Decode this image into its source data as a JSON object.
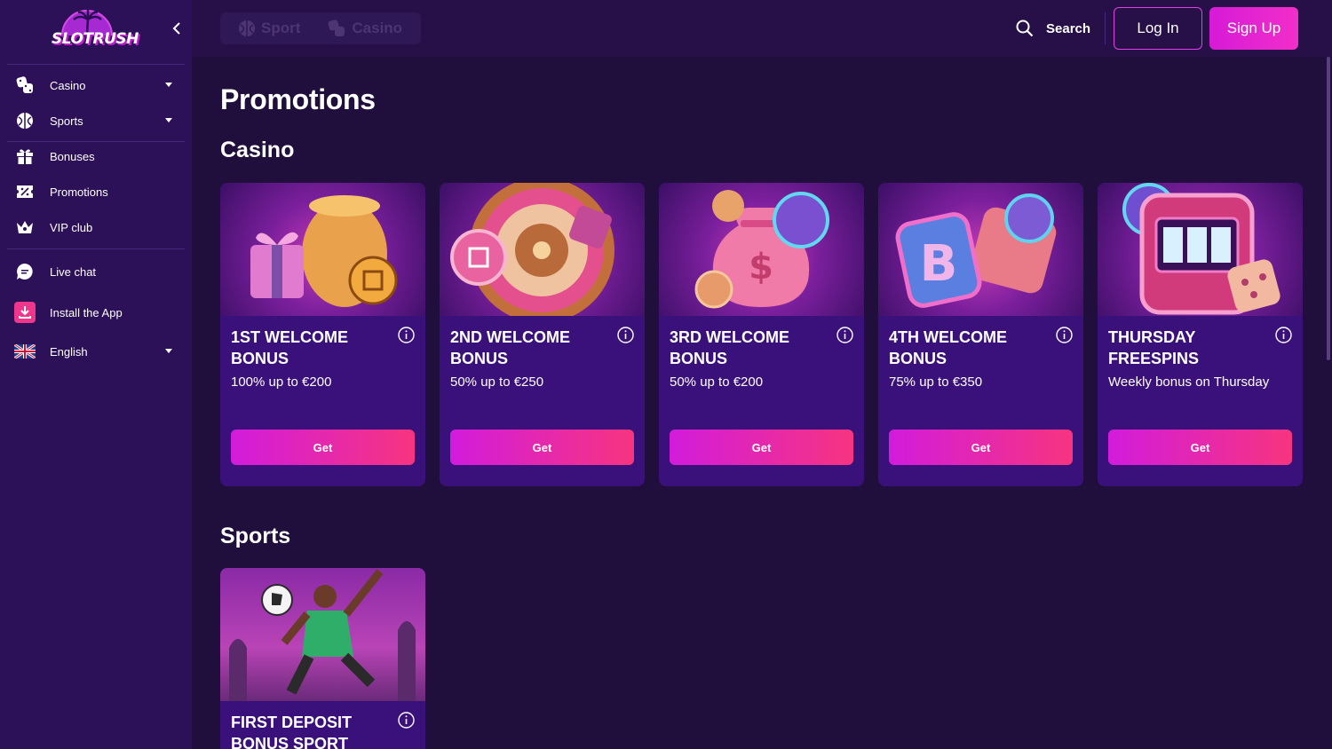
{
  "brand": {
    "name": "SLOTRUSH"
  },
  "sidebar": {
    "items": [
      {
        "label": "Casino",
        "icon": "dice-icon"
      },
      {
        "label": "Sports",
        "icon": "ball-icon"
      },
      {
        "label": "Bonuses",
        "icon": "gift-icon"
      },
      {
        "label": "Promotions",
        "icon": "ticket-icon"
      },
      {
        "label": "VIP club",
        "icon": "crown-icon"
      },
      {
        "label": "Live chat",
        "icon": "chat-icon"
      },
      {
        "label": "Install the App",
        "icon": "download-icon"
      },
      {
        "label": "English",
        "icon": "uk-flag-icon"
      }
    ]
  },
  "header": {
    "tabs": [
      {
        "label": "Sport"
      },
      {
        "label": "Casino"
      }
    ],
    "search_label": "Search",
    "login_label": "Log In",
    "signup_label": "Sign Up"
  },
  "main": {
    "title": "Promotions",
    "casino_section": {
      "title": "Casino",
      "cards": [
        {
          "title": "1st Welcome Bonus",
          "subtitle": "100% up to €200",
          "button": "Get"
        },
        {
          "title": "2nd Welcome Bonus",
          "subtitle": "50% up to €250",
          "button": "Get"
        },
        {
          "title": "3rd Welcome Bonus",
          "subtitle": "50% up to €200",
          "button": "Get"
        },
        {
          "title": "4th Welcome Bonus",
          "subtitle": "75% up to €350",
          "button": "Get"
        },
        {
          "title": "Thursday Freespins",
          "subtitle": "Weekly bonus on Thursday",
          "button": "Get"
        }
      ]
    },
    "sports_section": {
      "title": "Sports",
      "cards": [
        {
          "title": "First Deposit Bonus Sport"
        }
      ]
    }
  },
  "colors": {
    "background": "#200f3c",
    "sidebar": "#2d1158",
    "card": "#3a117a",
    "accent_start": "#d21cdc",
    "accent_end": "#f7347f",
    "login_border": "#e23ee8"
  }
}
